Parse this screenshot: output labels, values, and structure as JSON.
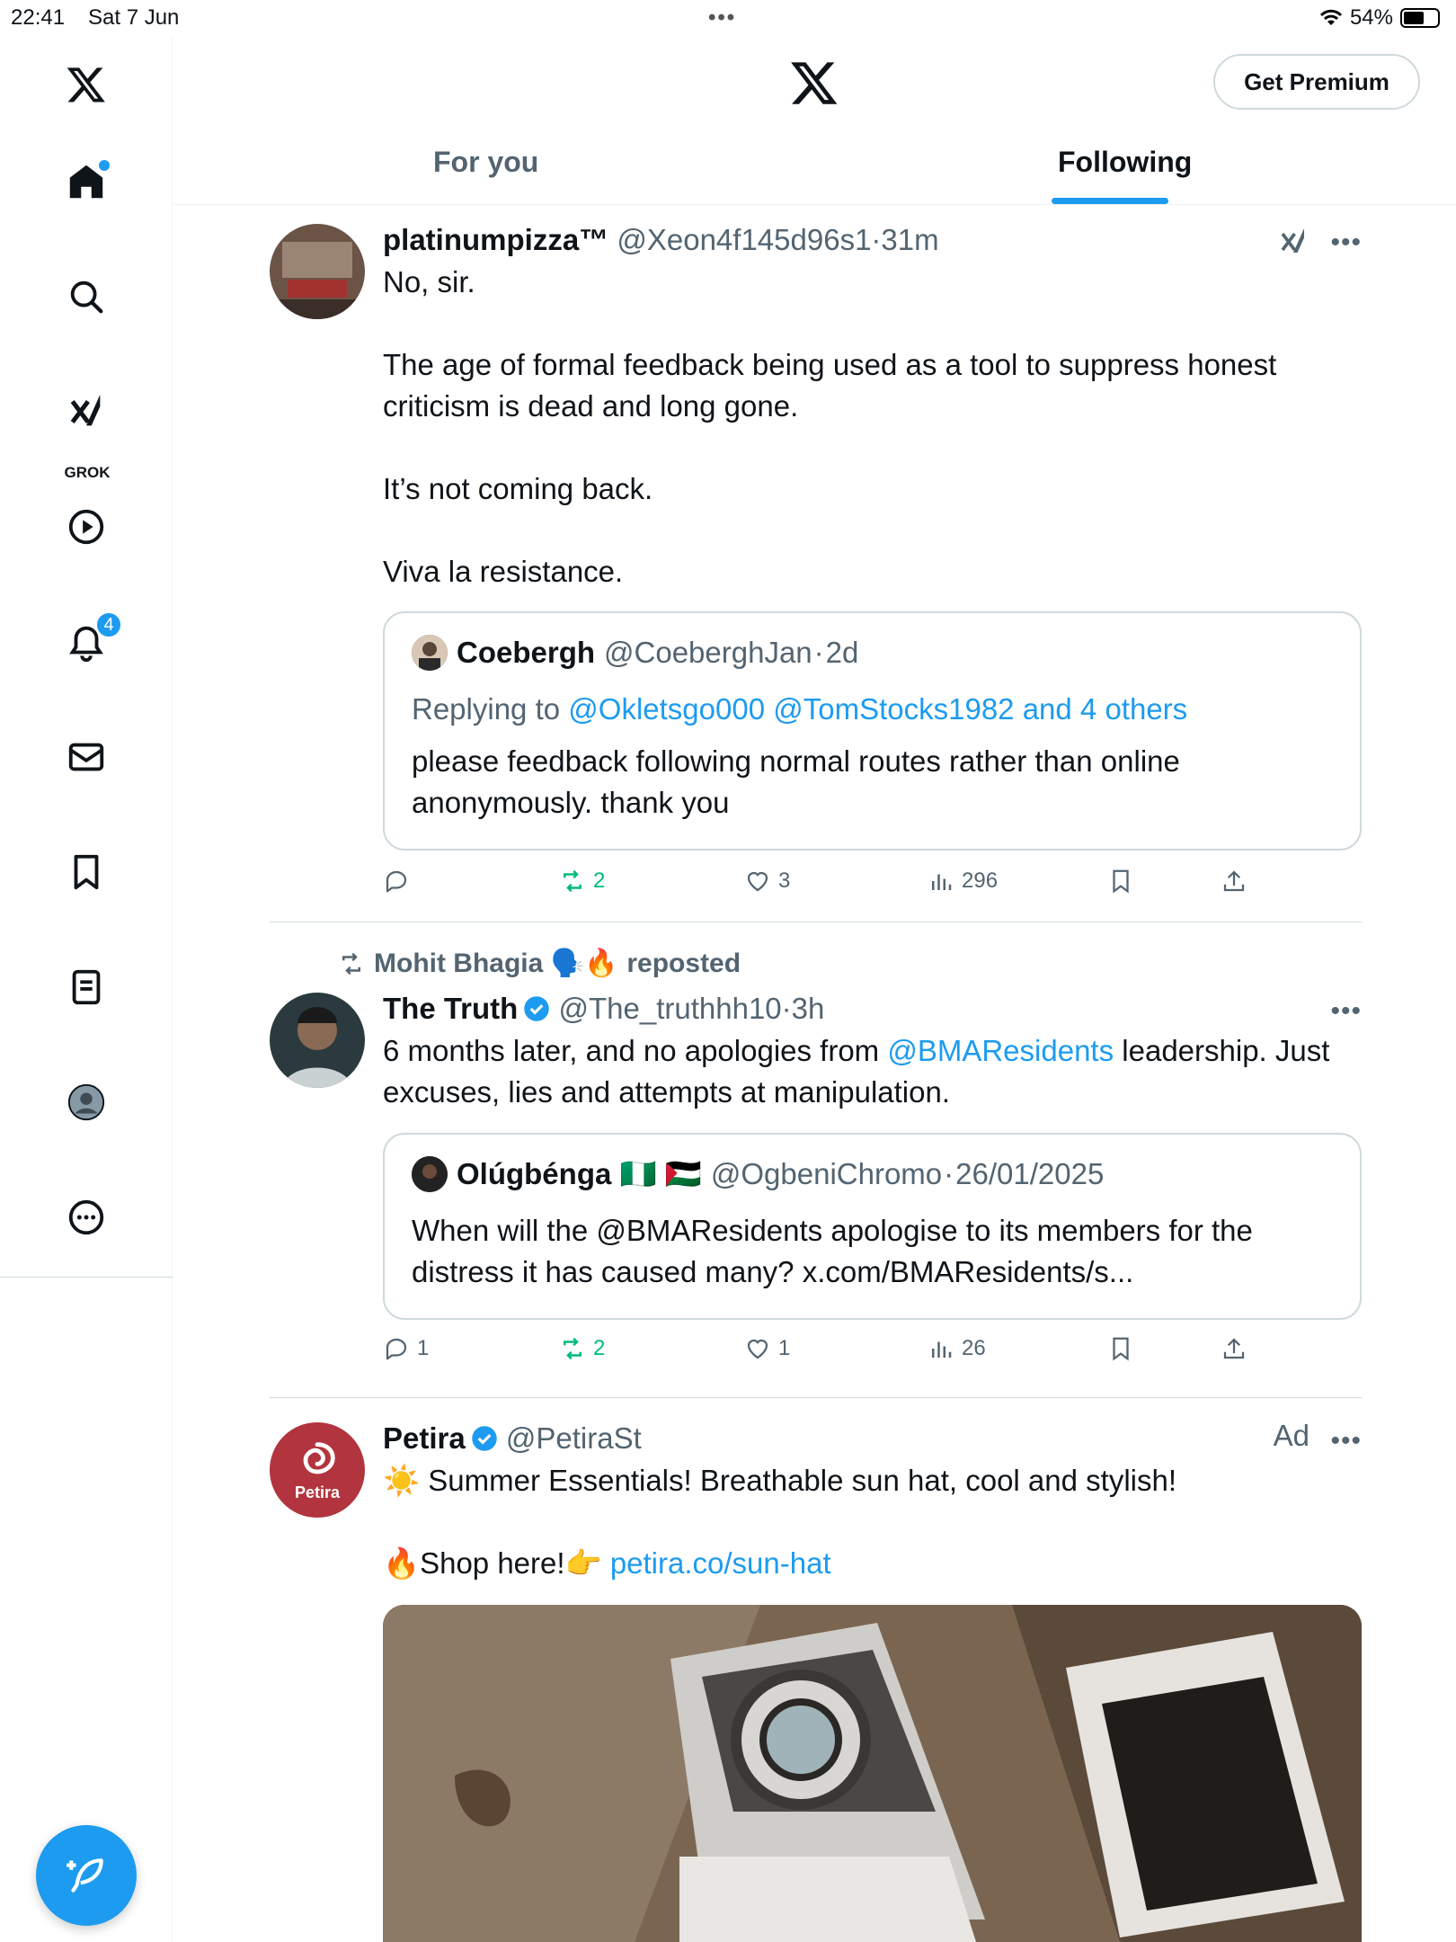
{
  "status_bar": {
    "time": "22:41",
    "date": "Sat 7 Jun",
    "battery": "54%"
  },
  "header": {
    "premium_label": "Get Premium",
    "tabs": [
      "For you",
      "Following"
    ],
    "active_tab": "Following"
  },
  "sidebar": {
    "items": [
      "home",
      "search",
      "grok",
      "videos",
      "notifications",
      "messages",
      "bookmarks",
      "lists",
      "profile",
      "more"
    ],
    "grok_label": "GROK",
    "notification_count": "4"
  },
  "tweets": [
    {
      "name": "platinumpizza™",
      "handle": "@Xeon4f145d96s1",
      "time": "31m",
      "text": "No, sir.\n\nThe age of formal feedback being used as a tool to suppress honest criticism is dead and long gone.\n\nIt’s not coming back.\n\nViva la resistance.",
      "quote": {
        "name": "Coebergh",
        "handle": "@CoeberghJan",
        "time": "2d",
        "replying_prefix": "Replying to",
        "replying_to": "@Okletsgo000 @TomStocks1982 and 4 others",
        "text": "please feedback following normal routes rather than online anonymously. thank you"
      },
      "stats": {
        "replies": "",
        "reposts": "2",
        "likes": "3",
        "views": "296"
      }
    },
    {
      "repost_by": "Mohit Bhagia 🗣️🔥",
      "repost_suffix": "reposted",
      "name": "The Truth",
      "handle": "@The_truthhh10",
      "time": "3h",
      "text_before": "6 months later, and no apologies from ",
      "text_link": "@BMAResidents",
      "text_after": " leadership. Just excuses, lies and attempts at manipulation.",
      "quote": {
        "name": "Olúgbénga 🇳🇬 🇵🇸",
        "handle": "@OgbeniChromo",
        "time": "26/01/2025",
        "text": "When will the @BMAResidents apologise to its members for the distress it has caused many? x.com/BMAResidents/s..."
      },
      "stats": {
        "replies": "1",
        "reposts": "2",
        "likes": "1",
        "views": "26"
      }
    },
    {
      "name": "Petira",
      "handle": "@PetiraSt",
      "ad_label": "Ad",
      "avatar_text": "Petira",
      "line1": "☀️ Summer Essentials! Breathable sun hat, cool and stylish!",
      "line2_prefix": "🔥Shop here!👉 ",
      "link": "petira.co/sun-hat"
    }
  ],
  "colors": {
    "accent": "#1d9bf0",
    "repost": "#00ba7c",
    "muted": "#536471"
  }
}
